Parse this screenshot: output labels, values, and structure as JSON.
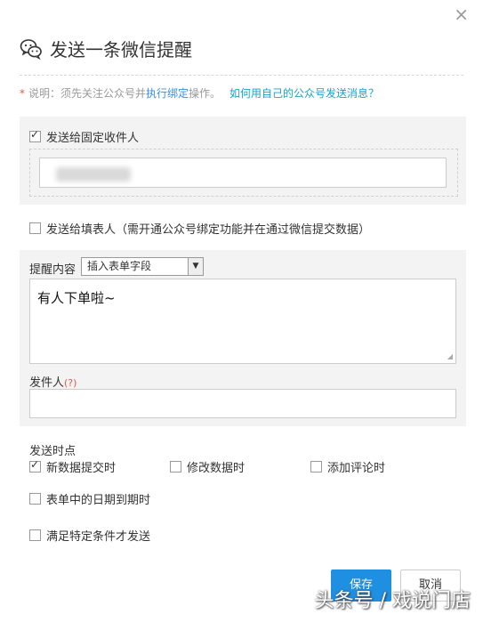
{
  "dialog": {
    "title": "发送一条微信提醒",
    "close_glyph": "×"
  },
  "note": {
    "star": "*",
    "prefix": "说明：须先关注公众号并",
    "link": "执行绑定",
    "suffix": "操作。",
    "help_link": "如何用自己的公众号发送消息？"
  },
  "fixed_recipient": {
    "label": "发送给固定收件人",
    "checked": true
  },
  "form_filler": {
    "label": "发送给填表人（需开通公众号绑定功能并在通过微信提交数据）",
    "checked": false
  },
  "content": {
    "label": "提醒内容",
    "select_value": "插入表单字段",
    "text": "有人下单啦~"
  },
  "sender": {
    "label": "发件人",
    "help": "(?)",
    "value": ""
  },
  "timing": {
    "label": "发送时点",
    "options": [
      {
        "label": "新数据提交时",
        "checked": true
      },
      {
        "label": "修改数据时",
        "checked": false
      },
      {
        "label": "添加评论时",
        "checked": false
      },
      {
        "label": "表单中的日期到期时",
        "checked": false
      },
      {
        "label": "满足特定条件才发送",
        "checked": false
      }
    ]
  },
  "buttons": {
    "save": "保存",
    "cancel": "取消"
  },
  "watermark": "头条号 / 戏说门店",
  "colors": {
    "primary": "#1e8fe1",
    "link": "#3a8ee6",
    "panel_bg": "#f3f3f3"
  }
}
